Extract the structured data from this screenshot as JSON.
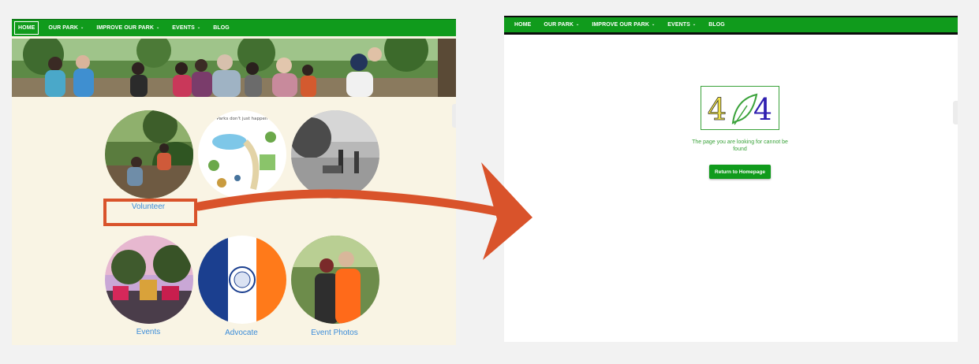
{
  "nav": {
    "home": "HOME",
    "our_park": "OUR PARK",
    "improve": "IMPROVE OUR PARK",
    "events": "EVENTS",
    "blog": "BLOG",
    "caret": "⌄"
  },
  "left": {
    "tiles": {
      "volunteer": "Volunteer",
      "events": "Events",
      "advocate": "Advocate",
      "event_photos": "Event Photos"
    },
    "illustration_text": "Parks don't just happen"
  },
  "right": {
    "logo": {
      "first": "4",
      "last": "4"
    },
    "message": "The page you are looking for cannot be found",
    "button": "Return to Homepage"
  },
  "colors": {
    "nav_green": "#109b1c",
    "link_blue": "#3b8cd9",
    "highlight_orange": "#d9532b",
    "cream": "#f9f4e4"
  }
}
